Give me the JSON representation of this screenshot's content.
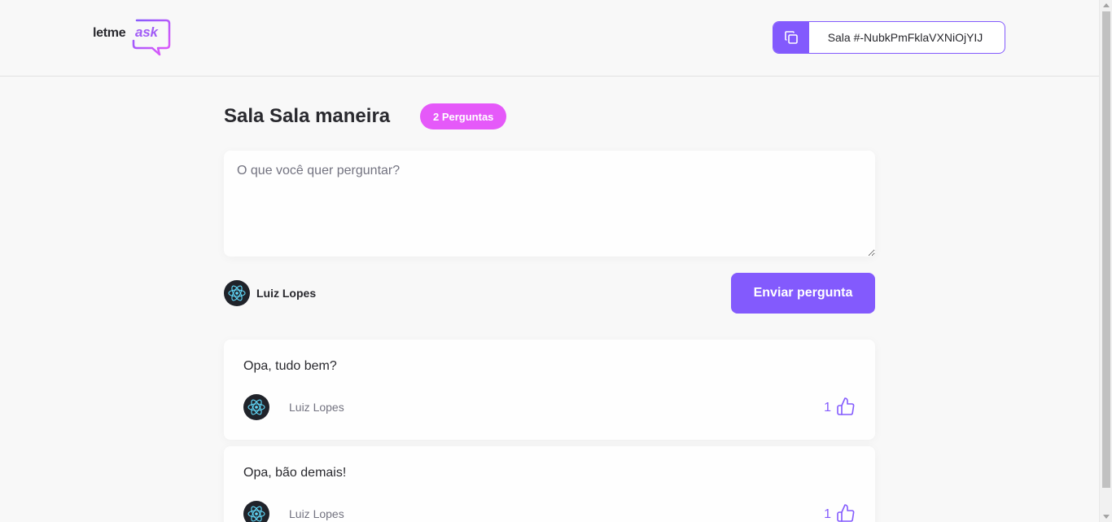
{
  "header": {
    "logo": {
      "text_main": "letme",
      "text_accent": "ask"
    },
    "room_code": {
      "label": "Sala #-NubkPmFklaVXNiOjYIJ",
      "copy_icon": "copy-icon"
    }
  },
  "room": {
    "title": "Sala Sala maneira",
    "question_count": "2 Perguntas"
  },
  "form": {
    "placeholder": "O que você quer perguntar?",
    "value": "",
    "user_name": "Luiz Lopes",
    "submit_label": "Enviar pergunta"
  },
  "questions": [
    {
      "content": "Opa, tudo bem?",
      "author": "Luiz Lopes",
      "likes": "1"
    },
    {
      "content": "Opa, bão demais!",
      "author": "Luiz Lopes",
      "likes": "1"
    }
  ],
  "colors": {
    "primary": "#835afd",
    "badge": "#e559f9",
    "background": "#f8f8f8",
    "text": "#29292e",
    "muted": "#737380"
  }
}
